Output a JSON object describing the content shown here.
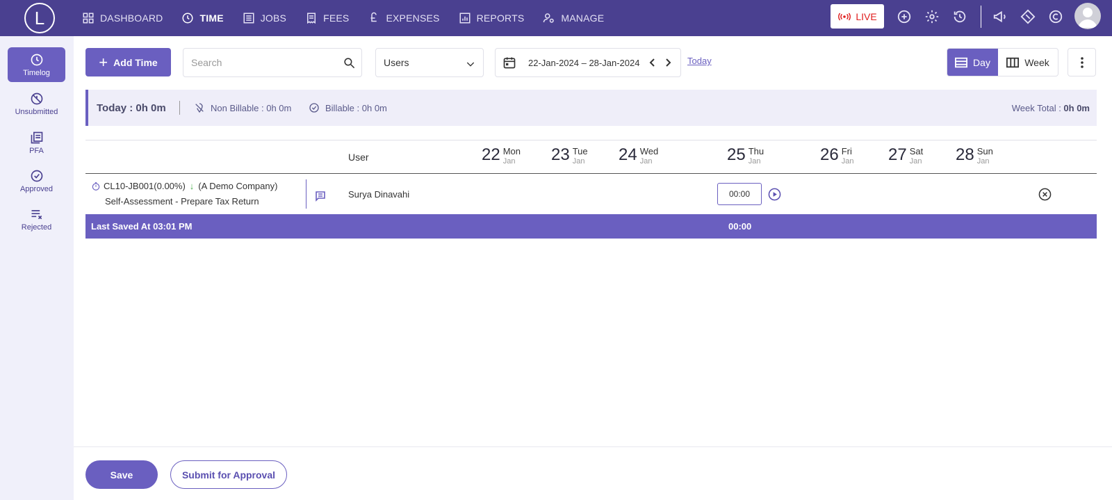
{
  "app": {
    "logo_letter": "L"
  },
  "nav": {
    "items": [
      {
        "label": "DASHBOARD",
        "icon": "grid-icon"
      },
      {
        "label": "TIME",
        "icon": "clock-icon"
      },
      {
        "label": "JOBS",
        "icon": "list-icon"
      },
      {
        "label": "FEES",
        "icon": "receipt-icon"
      },
      {
        "label": "EXPENSES",
        "icon": "pound-icon"
      },
      {
        "label": "REPORTS",
        "icon": "chart-icon"
      },
      {
        "label": "MANAGE",
        "icon": "users-gear-icon"
      }
    ],
    "live_label": "LIVE"
  },
  "sidebar": {
    "items": [
      {
        "label": "Timelog"
      },
      {
        "label": "Unsubmitted"
      },
      {
        "label": "PFA"
      },
      {
        "label": "Approved"
      },
      {
        "label": "Rejected"
      }
    ]
  },
  "toolbar": {
    "add_time": "Add Time",
    "search_placeholder": "Search",
    "users_label": "Users",
    "date_range": "22-Jan-2024 – 28-Jan-2024",
    "today_link": "Today",
    "view_day": "Day",
    "view_week": "Week"
  },
  "summary": {
    "today": "Today : 0h 0m",
    "non_billable": "Non Billable : 0h 0m",
    "billable": "Billable : 0h 0m",
    "week_total_label": "Week Total : ",
    "week_total_value": "0h 0m"
  },
  "grid": {
    "user_header": "User",
    "days": [
      {
        "num": "22",
        "name": "Mon",
        "month": "Jan"
      },
      {
        "num": "23",
        "name": "Tue",
        "month": "Jan"
      },
      {
        "num": "24",
        "name": "Wed",
        "month": "Jan"
      },
      {
        "num": "25",
        "name": "Thu",
        "month": "Jan"
      },
      {
        "num": "26",
        "name": "Fri",
        "month": "Jan"
      },
      {
        "num": "27",
        "name": "Sat",
        "month": "Jan"
      },
      {
        "num": "28",
        "name": "Sun",
        "month": "Jan"
      }
    ],
    "row": {
      "job": "CL10-JB001(0.00%)",
      "arrow": "↓",
      "company": "(A Demo Company)",
      "task": "Self-Assessment - Prepare Tax Return",
      "user": "Surya Dinavahi",
      "time_value": "00:00"
    },
    "footer": {
      "last_saved": "Last Saved At 03:01 PM",
      "total": "00:00"
    }
  },
  "actions": {
    "save": "Save",
    "submit": "Submit for Approval"
  },
  "colors": {
    "nav_bg": "#4a4090",
    "accent": "#6a5fc0",
    "live": "#e01e1e",
    "arrow_green": "#4caf50"
  }
}
